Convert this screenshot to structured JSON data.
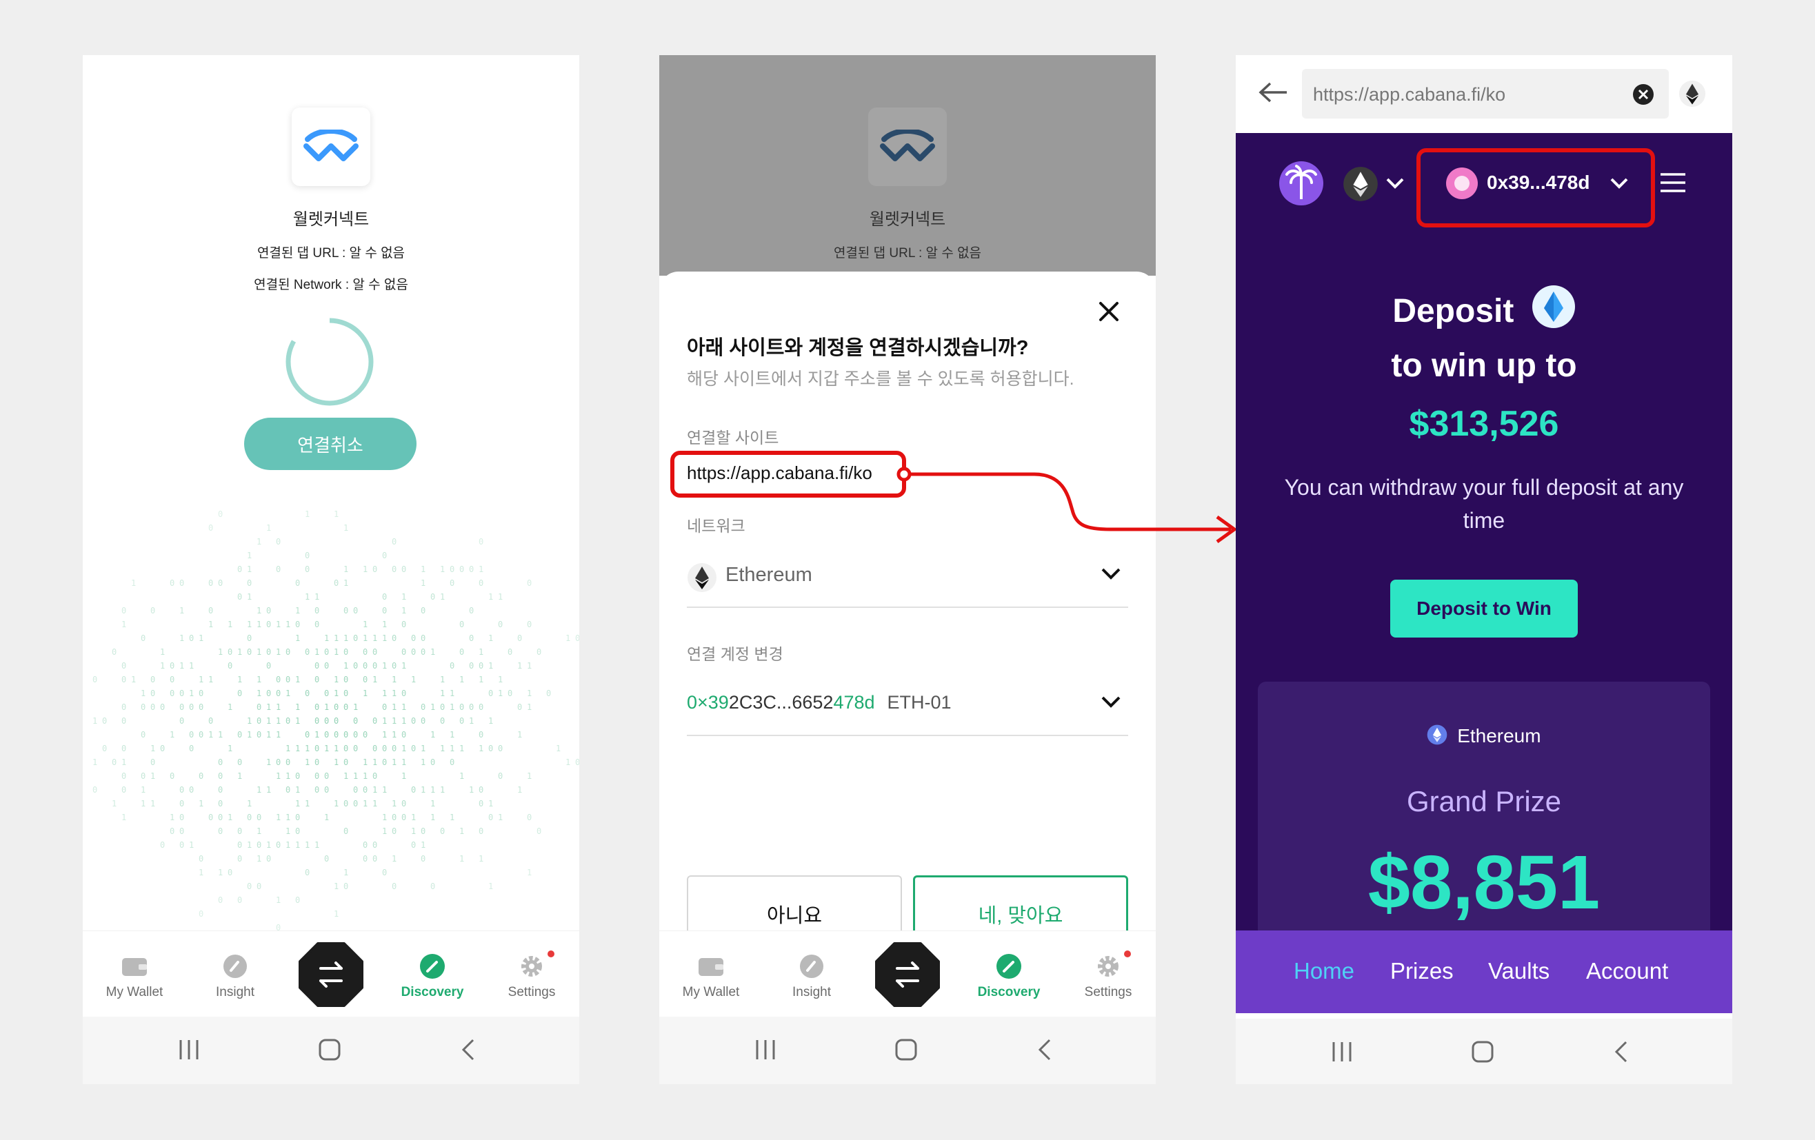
{
  "panel1": {
    "title": "월렛커넥트",
    "dapp_url_line": "연결된 댑 URL : 알 수 없음",
    "network_line": "연결된 Network : 알 수 없음",
    "cancel_label": "연결취소"
  },
  "panel2": {
    "title": "월렛커넥트",
    "dapp_url_line": "연결된 댑 URL : 알 수 없음",
    "question": "아래 사이트와 계정을 연결하시겠습니까?",
    "subtitle": "해당 사이트에서 지갑 주소를 볼 수 있도록 허용합니다.",
    "site_label": "연결할 사이트",
    "site_url": "https://app.cabana.fi/ko",
    "network_label": "네트워크",
    "network_value": "Ethereum",
    "account_label": "연결 계정 변경",
    "account_prefix": "0×39",
    "account_middle": "2C3C...6652",
    "account_suffix": "478d",
    "account_name": "ETH-01",
    "no_label": "아니요",
    "yes_label": "네, 맞아요"
  },
  "app_nav": {
    "items": [
      {
        "label": "My Wallet",
        "icon": "wallet-icon"
      },
      {
        "label": "Insight",
        "icon": "insight-icon"
      },
      {
        "label": "",
        "icon": "swap-icon"
      },
      {
        "label": "Discovery",
        "icon": "discovery-icon"
      },
      {
        "label": "Settings",
        "icon": "gear-icon"
      }
    ]
  },
  "panel3": {
    "url": "https://app.cabana.fi/ko",
    "account": "0x39...478d",
    "deposit": "Deposit",
    "win_line": "to win up to",
    "amount": "$313,526",
    "description": "You can withdraw your full deposit at any time",
    "cta": "Deposit to Win",
    "card_network": "Ethereum",
    "card_title": "Grand Prize",
    "card_amount": "$8,851",
    "tabs": [
      "Home",
      "Prizes",
      "Vaults",
      "Account"
    ]
  },
  "colors": {
    "accent_green": "#1eaa6f",
    "teal_button": "#66c3b7",
    "dapp_bg": "#2b0b5a",
    "dapp_cta": "#2de5c4",
    "tab_bar": "#6e3cc8",
    "highlight_red": "#e31010"
  }
}
